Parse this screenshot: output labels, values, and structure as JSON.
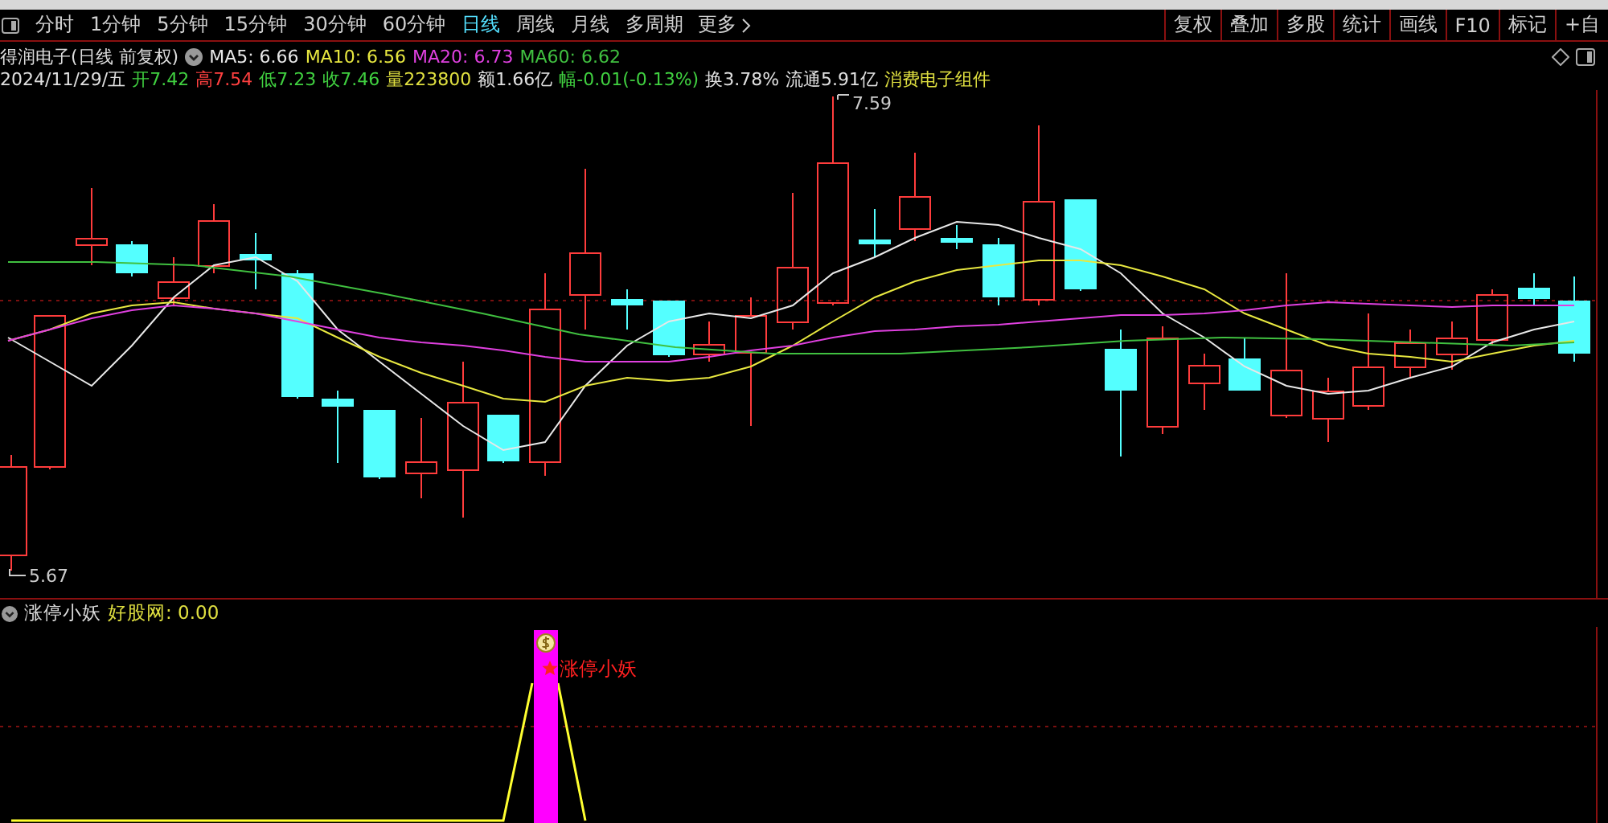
{
  "toolbar": {
    "periods": [
      {
        "label": "分时",
        "selected": false
      },
      {
        "label": "1分钟",
        "selected": false
      },
      {
        "label": "5分钟",
        "selected": false
      },
      {
        "label": "15分钟",
        "selected": false
      },
      {
        "label": "30分钟",
        "selected": false
      },
      {
        "label": "60分钟",
        "selected": false
      },
      {
        "label": "日线",
        "selected": true
      },
      {
        "label": "周线",
        "selected": false
      },
      {
        "label": "月线",
        "selected": false
      },
      {
        "label": "多周期",
        "selected": false
      }
    ],
    "more": "更多",
    "buttons": [
      "复权",
      "叠加",
      "多股",
      "统计",
      "画线",
      "F10",
      "标记",
      "+自"
    ]
  },
  "chart": {
    "title": "得润电子(日线 前复权)",
    "ma": [
      {
        "label": "MA5: 6.66",
        "color": "#e8e8e8"
      },
      {
        "label": "MA10: 6.56",
        "color": "#e8e840"
      },
      {
        "label": "MA20: 6.73",
        "color": "#e040e0"
      },
      {
        "label": "MA60: 6.62",
        "color": "#40c040"
      }
    ],
    "quote": [
      {
        "text": "2024/11/29/五",
        "color": "#e0e0e0"
      },
      {
        "text": "开7.42",
        "color": "#40d040"
      },
      {
        "text": "高7.54",
        "color": "#ff4040"
      },
      {
        "text": "低7.23",
        "color": "#40d040"
      },
      {
        "text": "收7.46",
        "color": "#40d040"
      },
      {
        "text": "量223800",
        "color": "#e0e040"
      },
      {
        "text": "额1.66亿",
        "color": "#e0e0e0"
      },
      {
        "text": "幅-0.01(-0.13%)",
        "color": "#40d040"
      },
      {
        "text": "换3.78%",
        "color": "#e0e0e0"
      },
      {
        "text": "流通5.91亿",
        "color": "#e0e0e0"
      }
    ],
    "sector": "消费电子组件",
    "high_marker": "7.59",
    "low_marker": "5.67"
  },
  "indicator": {
    "name": "涨停小妖",
    "value_label": "好股网: 0.00",
    "signal_label": "涨停小妖"
  }
}
